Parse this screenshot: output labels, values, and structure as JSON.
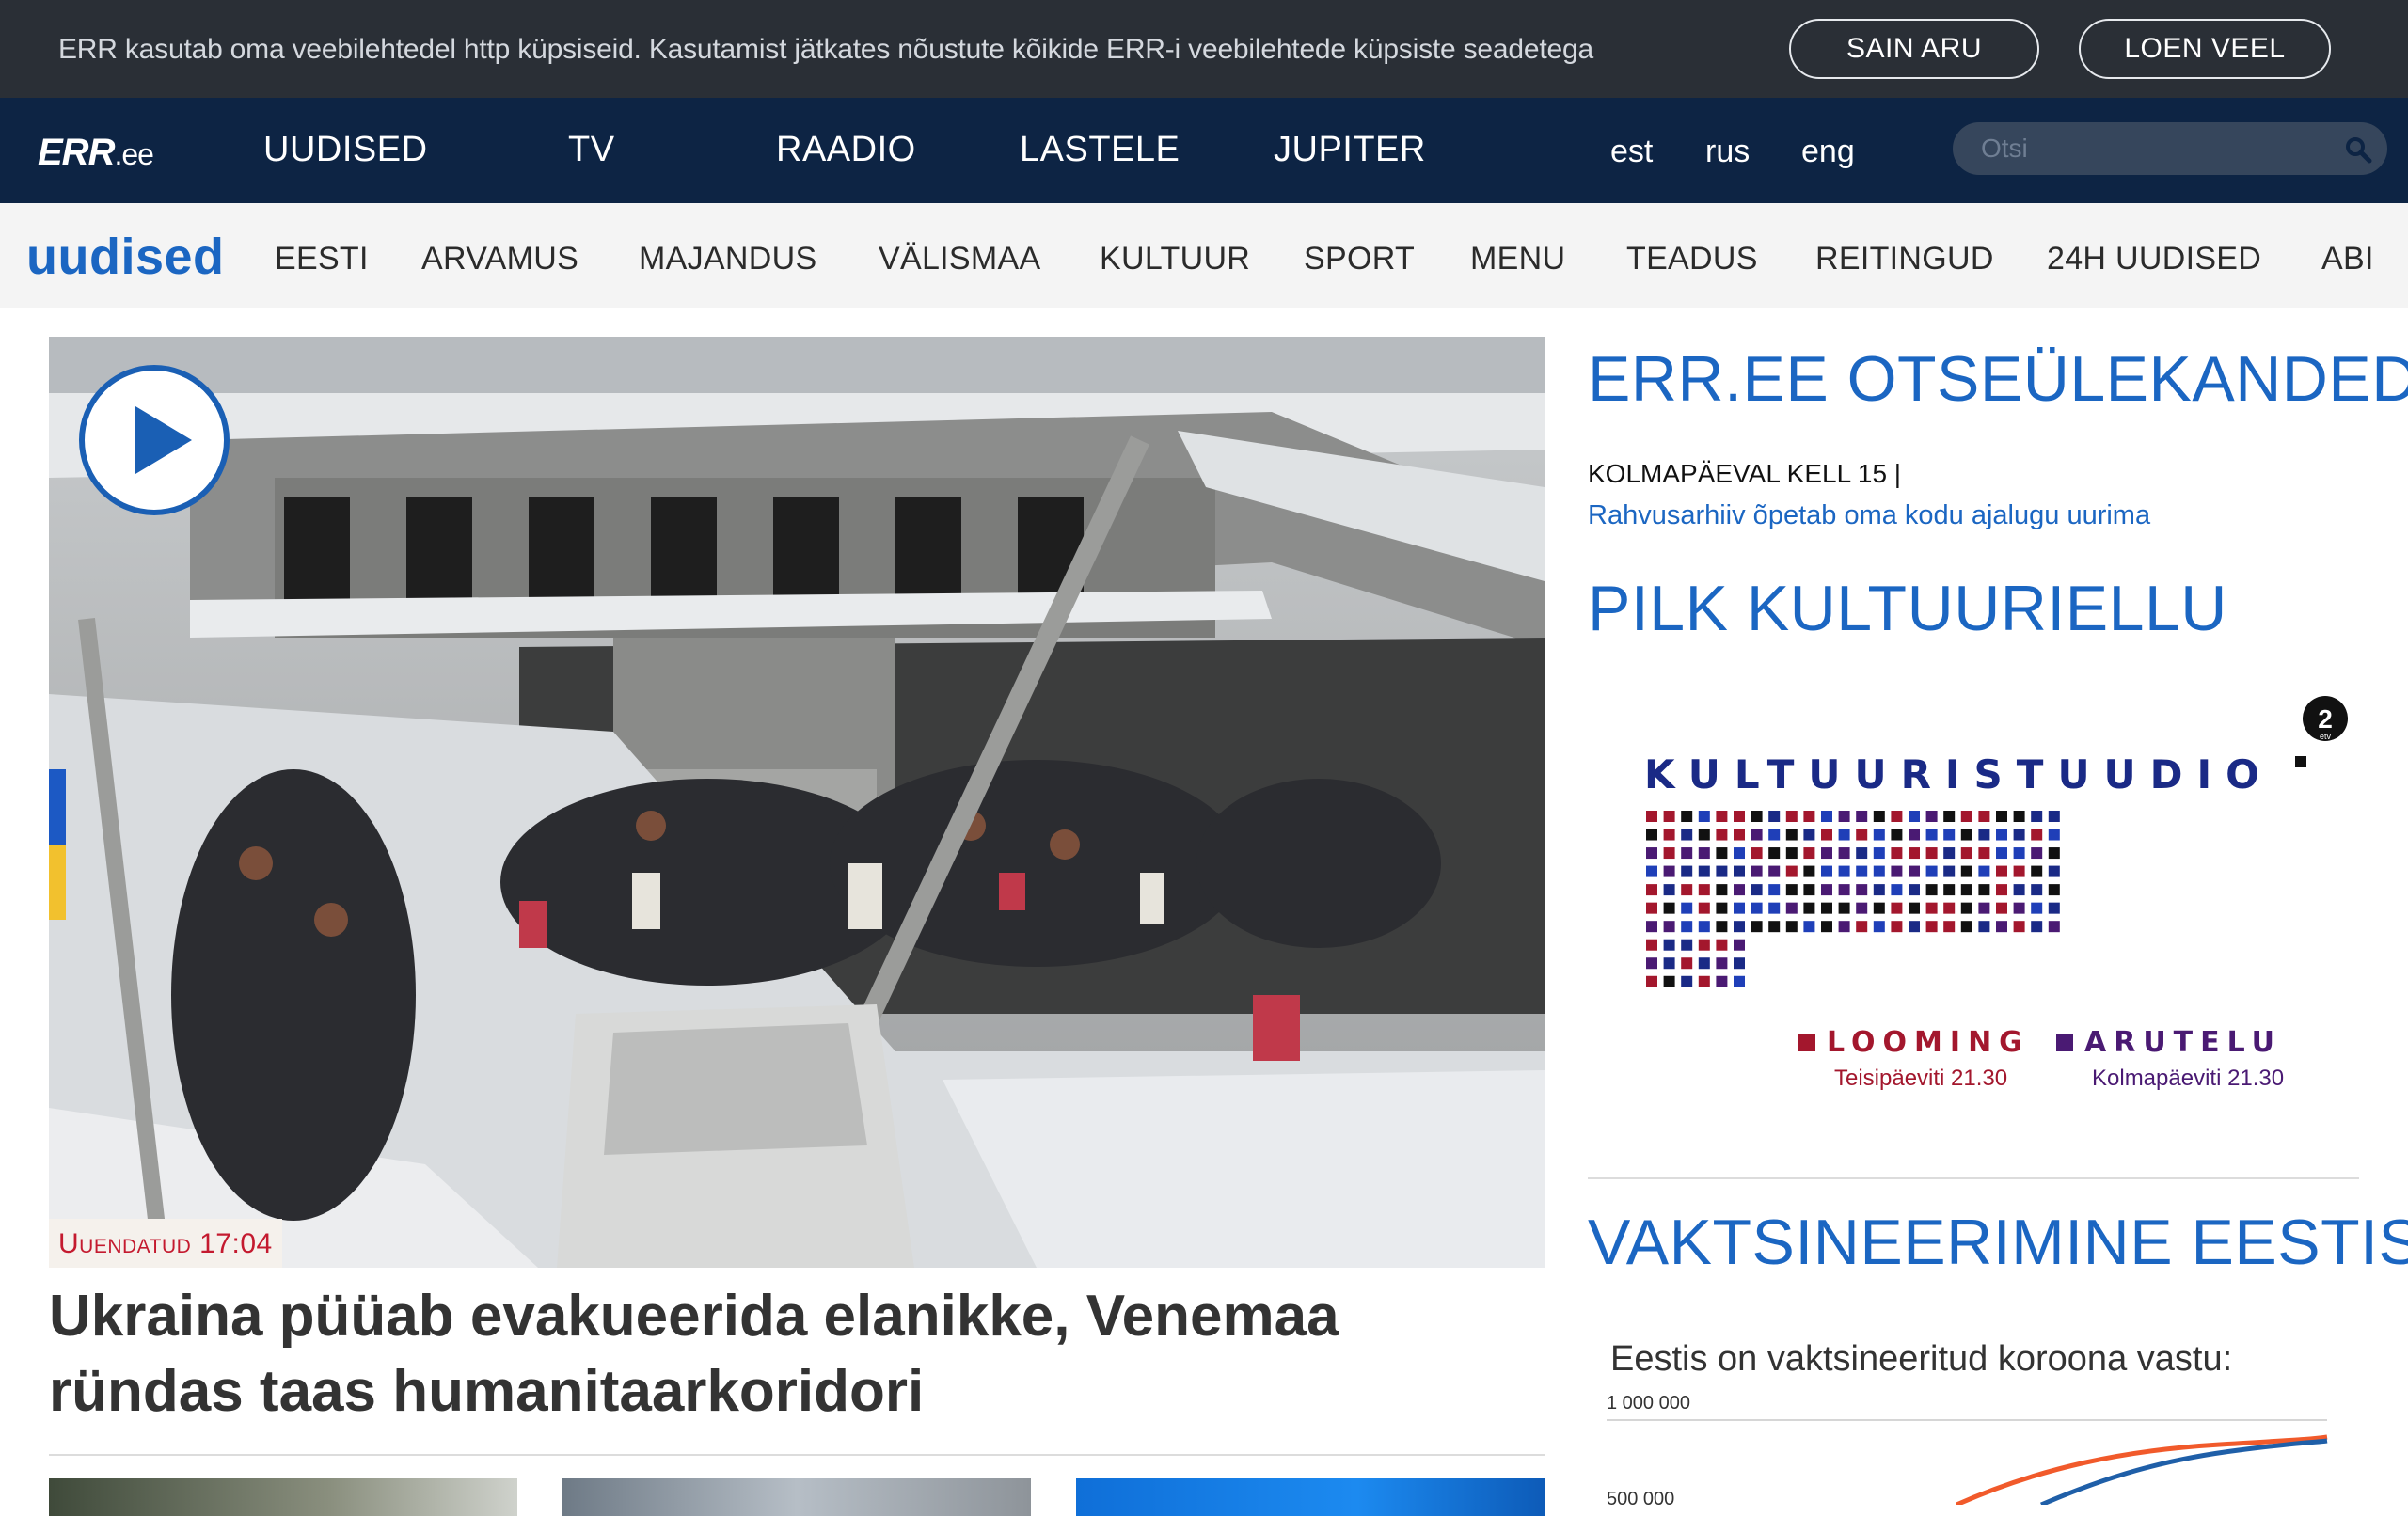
{
  "cookie": {
    "text": "ERR kasutab oma veebilehtedel http küpsiseid. Kasutamist jätkates nõustute kõikide ERR-i veebilehtede küpsiste seadetega",
    "accept_label": "SAIN ARU",
    "more_label": "LOEN VEEL"
  },
  "topnav": {
    "logo": "ERR",
    "logo_suffix": ".ee",
    "items": [
      "UUDISED",
      "TV",
      "RAADIO",
      "LASTELE",
      "JUPITER"
    ],
    "languages": [
      "est",
      "rus",
      "eng"
    ],
    "search_placeholder": "Otsi"
  },
  "secnav": {
    "title": "uudised",
    "items": [
      "EESTI",
      "ARVAMUS",
      "MAJANDUS",
      "VÄLISMAA",
      "KULTUUR",
      "SPORT",
      "MENU",
      "TEADUS",
      "REITINGUD",
      "24H UUDISED",
      "ABI"
    ]
  },
  "main": {
    "updated": "Uuendatud 17:04",
    "headline_line1": "Ukraina püüab evakueerida elanikke, Venemaa",
    "headline_line2": "ründas taas humanitaarkoridori"
  },
  "sidebar": {
    "live_heading": "ERR.EE OTSEÜLEKANDED",
    "live_time": "KOLMAPÄEVAL KELL 15 |",
    "live_link": "Rahvusarhiiv õpetab oma kodu ajalugu uurima",
    "culture_heading": "PILK KULTUURIELLU",
    "promo": {
      "title": "KULTUURISTUUDIO",
      "channel": "2",
      "channel_sub": "etv",
      "left_label": "LOOMING",
      "left_time": "Teisipäeviti 21.30",
      "right_label": "ARUTELU",
      "right_time": "Kolmapäeviti 21.30"
    },
    "vax_heading": "VAKTSINEERIMINE EESTIS",
    "vax_subtitle": "Eestis on vaktsineeritud koroona vastu:",
    "vax_tick_top": "1 000 000",
    "vax_tick_mid": "500 000"
  },
  "colors": {
    "cookie_bg": "#2a2f36",
    "nav_bg": "#0d2444",
    "brand_blue": "#1b66c2",
    "accent_red": "#c41a2f"
  }
}
